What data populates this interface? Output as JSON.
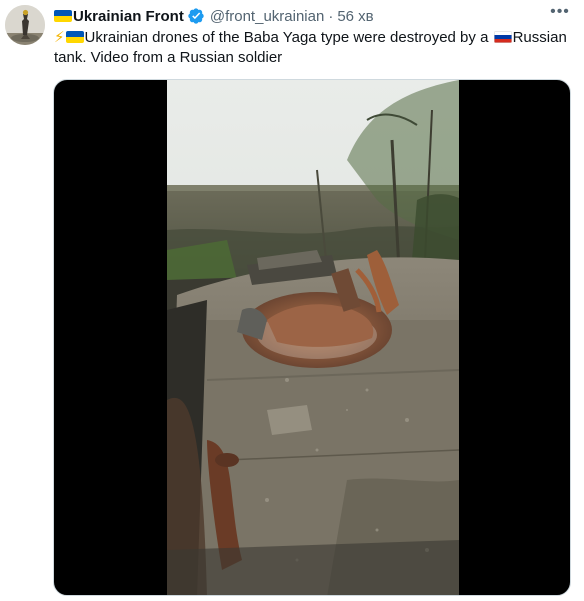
{
  "tweet": {
    "display_name": "Ukrainian Front",
    "handle": "@front_ukrainian",
    "separator": "·",
    "timestamp": "56 хв",
    "more_label": "•••",
    "text_part1": "Ukrainian drones of the Baba Yaga type were destroyed by a ",
    "text_part2": "Russian tank. Video from a Russian soldier",
    "icons": {
      "leading_flag": "ukraine-flag-icon",
      "lightning": "high-voltage-icon",
      "inline_flag_1": "ukraine-flag-icon",
      "inline_flag_2": "russia-flag-icon",
      "verified": "verified-badge-icon"
    },
    "colors": {
      "text": "#0f1419",
      "secondary": "#536471",
      "verified": "#1d9bf0",
      "media_border": "#cfd9de"
    }
  }
}
